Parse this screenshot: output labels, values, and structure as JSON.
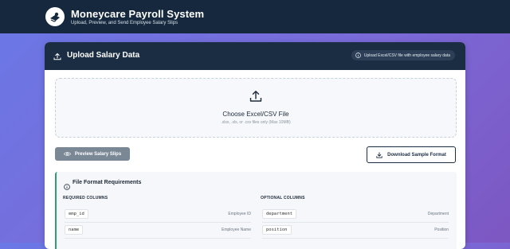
{
  "header": {
    "title": "Moneycare Payroll System",
    "subtitle": "Upload, Preview, and Send Employee Salary Slips"
  },
  "upload_card": {
    "title": "Upload Salary Data",
    "hint": "Upload Excel/CSV file with employee salary data",
    "dropzone": {
      "title": "Choose Excel/CSV File",
      "subtitle": ".xlsx, .xls, or .csv files only (Max 10MB)"
    },
    "preview_button": "Preview Salary Slips",
    "download_button": "Download Sample Format"
  },
  "format_requirements": {
    "title": "File Format Requirements",
    "required_heading": "REQUIRED COLUMNS",
    "optional_heading": "OPTIONAL COLUMNS",
    "required": [
      {
        "code": "emp_id",
        "desc": "Employee ID"
      },
      {
        "code": "name",
        "desc": "Employee Name"
      }
    ],
    "optional": [
      {
        "code": "department",
        "desc": "Department"
      },
      {
        "code": "position",
        "desc": "Position"
      }
    ]
  },
  "colors": {
    "header_bg": "#15283d",
    "card_header_bg": "#1b2d42",
    "accent_green": "#2e9e6e",
    "disabled_button": "#7a8896"
  },
  "icons": [
    "logo-icon",
    "upload-icon",
    "info-icon",
    "eye-icon",
    "download-icon"
  ]
}
